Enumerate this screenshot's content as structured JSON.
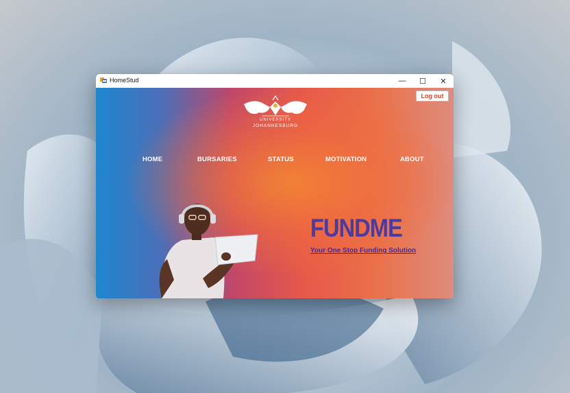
{
  "window": {
    "title": "HomeStud",
    "controls": {
      "minimize": "—",
      "maximize": "☐",
      "close": "✕"
    }
  },
  "header": {
    "logout_label": "Log out",
    "logo_line1": "UNIVERSITY",
    "logo_line2": "JOHANNESBURG"
  },
  "nav": {
    "items": [
      {
        "label": "HOME"
      },
      {
        "label": "BURSARIES"
      },
      {
        "label": "STATUS"
      },
      {
        "label": "MOTIVATION"
      },
      {
        "label": "ABOUT"
      }
    ]
  },
  "hero": {
    "title": "FUNDME",
    "subtitle": "Your One Stop Funding Solution"
  },
  "colors": {
    "title_color": "#4b3aa0",
    "logout_text": "#d9422c",
    "gradient_left": "#1f86cf",
    "gradient_center": "#ea7048"
  }
}
